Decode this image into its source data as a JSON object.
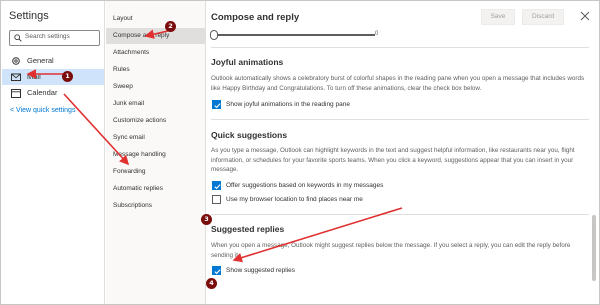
{
  "settings": {
    "title": "Settings",
    "search_placeholder": "Search settings",
    "nav": [
      {
        "label": "General",
        "icon": "gear-icon"
      },
      {
        "label": "Mail",
        "icon": "mail-icon",
        "selected": true
      },
      {
        "label": "Calendar",
        "icon": "calendar-icon"
      }
    ],
    "view_quick_settings": "View quick settings"
  },
  "mail_menu": [
    "Layout",
    "Compose and reply",
    "Attachments",
    "Rules",
    "Sweep",
    "Junk email",
    "Customize actions",
    "Sync email",
    "Message handling",
    "Forwarding",
    "Automatic replies",
    "Subscriptions"
  ],
  "panel": {
    "title": "Compose and reply",
    "save_label": "Save",
    "discard_label": "Discard",
    "slider_value": "0",
    "joyful": {
      "heading": "Joyful animations",
      "description": "Outlook automatically shows a celebratory burst of colorful shapes in the reading pane when you open a message that includes words like Happy Birthday and Congratulations. To turn off these animations, clear the check box below.",
      "checkbox": "Show joyful animations in the reading pane",
      "checked": true
    },
    "quick": {
      "heading": "Quick suggestions",
      "description": "As you type a message, Outlook can highlight keywords in the text and suggest helpful information, like restaurants near you, flight information, or schedules for your favorite sports teams. When you click a keyword, suggestions appear that you can insert in your message.",
      "options": [
        {
          "label": "Offer suggestions based on keywords in my messages",
          "checked": true
        },
        {
          "label": "Use my browser location to find places near me",
          "checked": false
        }
      ]
    },
    "suggested": {
      "heading": "Suggested replies",
      "description": "When you open a message, Outlook might suggest replies below the message. If you select a reply, you can edit the reply before sending it.",
      "checkbox": "Show suggested replies",
      "checked": true
    }
  },
  "annotations": {
    "badges": [
      "1",
      "2",
      "3",
      "4"
    ],
    "color": "#7a0c0c",
    "arrow_color": "#e03030"
  },
  "colors": {
    "accent": "#0078d4",
    "nav_selected": "#cfe4fa"
  }
}
